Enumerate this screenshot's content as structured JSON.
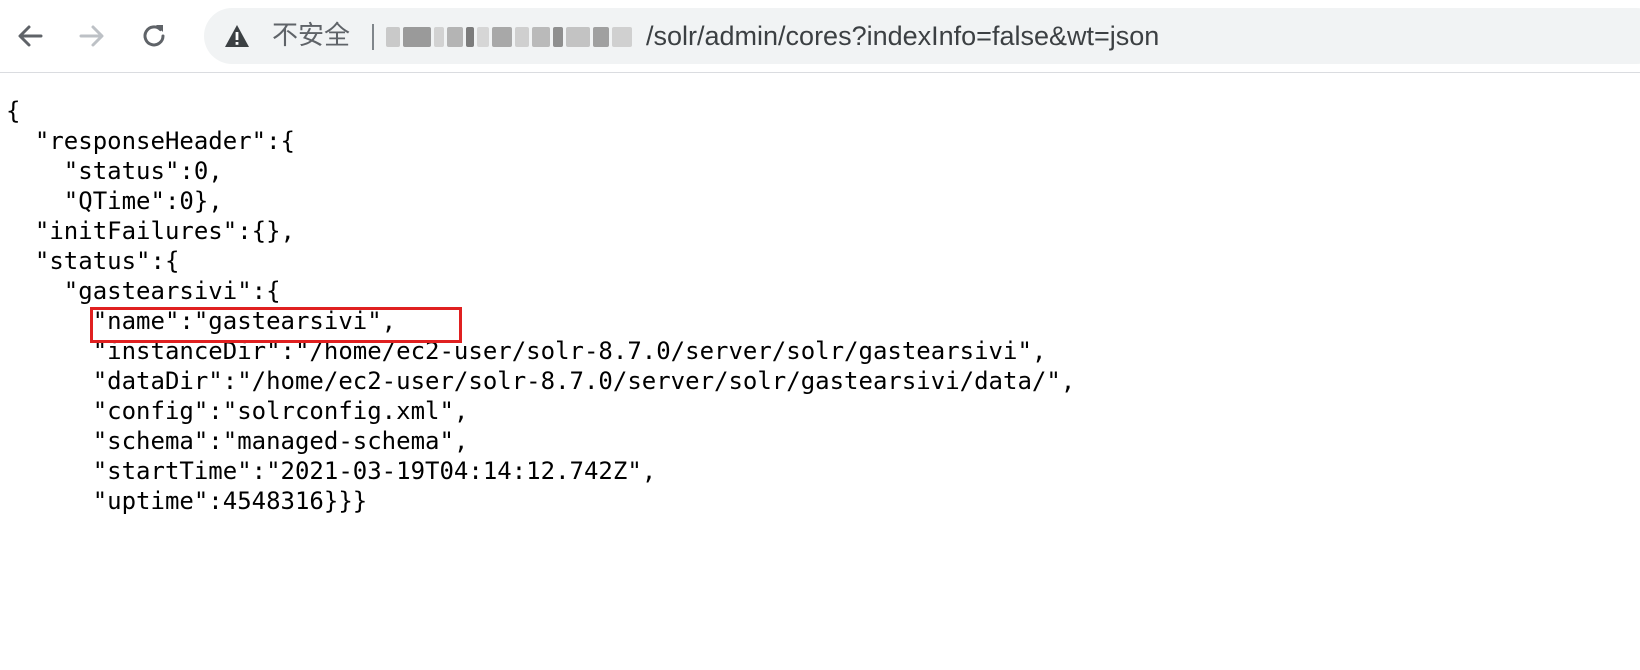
{
  "browser": {
    "security_label": "不安全",
    "url_path": "/solr/admin/cores?indexInfo=false&wt=json",
    "host_redacted": true
  },
  "json_lines": [
    "{",
    "  \"responseHeader\":{",
    "    \"status\":0,",
    "    \"QTime\":0},",
    "  \"initFailures\":{},",
    "  \"status\":{",
    "    \"gastearsivi\":{",
    "      \"name\":\"gastearsivi\",",
    "      \"instanceDir\":\"/home/ec2-user/solr-8.7.0/server/solr/gastearsivi\",",
    "      \"dataDir\":\"/home/ec2-user/solr-8.7.0/server/solr/gastearsivi/data/\",",
    "      \"config\":\"solrconfig.xml\",",
    "      \"schema\":\"managed-schema\",",
    "      \"startTime\":\"2021-03-19T04:14:12.742Z\",",
    "      \"uptime\":4548316}}}"
  ],
  "colors": {
    "highlight_border": "#e02020",
    "omnibox_bg": "#f1f3f4",
    "icon": "#5f6368"
  },
  "icons": {
    "back": "arrow-left-icon",
    "forward": "arrow-right-icon",
    "reload": "reload-icon",
    "security": "warning-triangle-icon"
  }
}
